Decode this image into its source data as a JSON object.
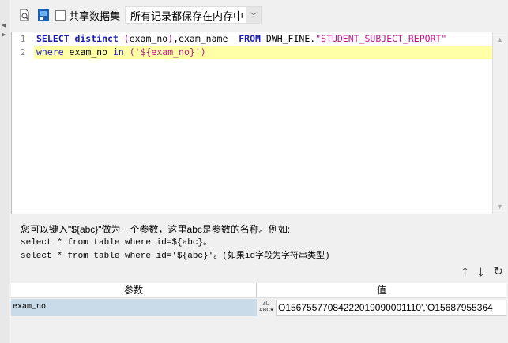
{
  "toolbar": {
    "share_dataset_label": "共享数据集",
    "cache_mode_selected": "所有记录都保存在内存中"
  },
  "editor": {
    "line_numbers": [
      "1",
      "2"
    ],
    "line1": {
      "kw1": "SELECT distinct",
      "p1": "(",
      "t1": "exam_no",
      "p2": ")",
      "t2": ",exam_name  ",
      "kw2": "FROM",
      "t3": " DWH_FINE.",
      "str": "\"STUDENT_SUBJECT_REPORT\""
    },
    "line2": {
      "kw1": "where",
      "t1": " exam_no ",
      "kw2": "in",
      "sp": " ",
      "str": "('${exam_no}')"
    }
  },
  "hint": {
    "line1": "您可以键入\"${abc}\"做为一个参数，这里abc是参数的名称。例如:",
    "line2": "select * from table where id=${abc}。",
    "line3": "select * from table where id='${abc}'。(如果id字段为字符串类型)"
  },
  "params_table": {
    "headers": [
      "参数",
      "值"
    ],
    "rows": [
      {
        "name": "exam_no",
        "value": "O15675577084222019090001110','O15687955364"
      }
    ]
  }
}
